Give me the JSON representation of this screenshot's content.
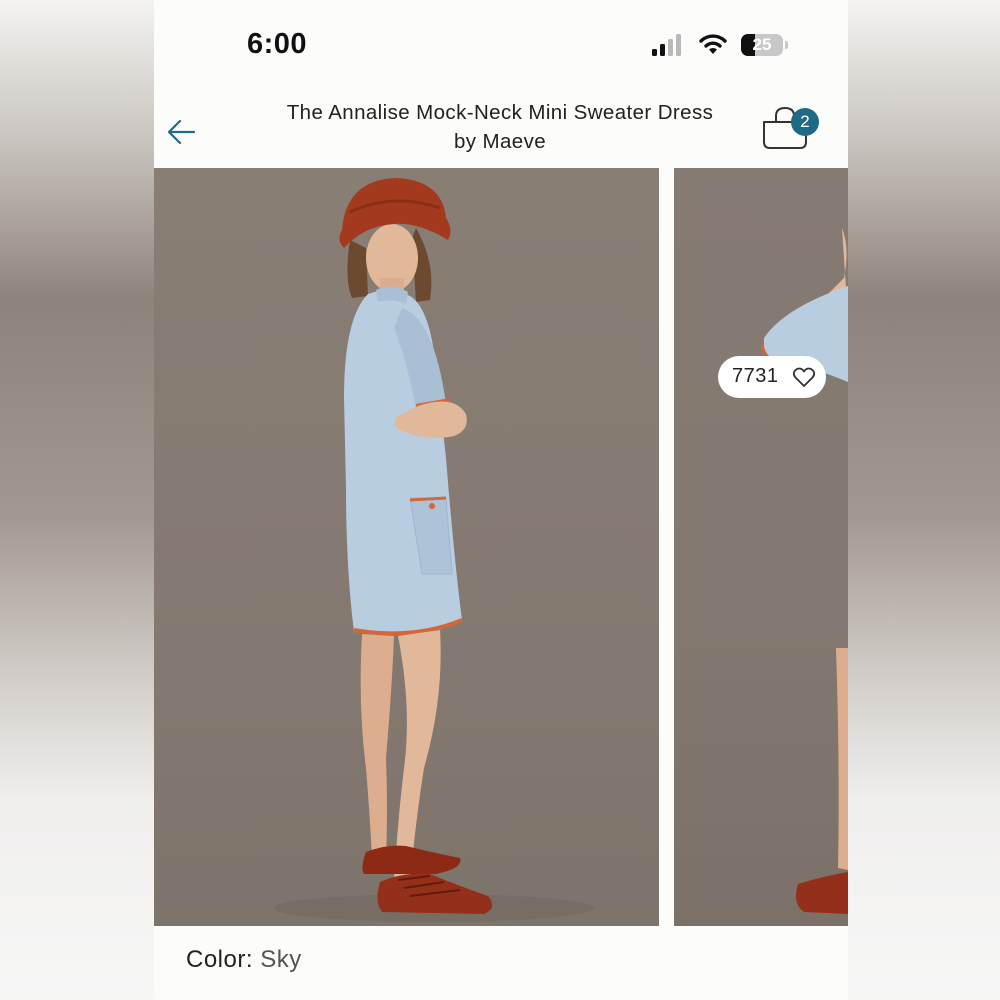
{
  "status_bar": {
    "time": "6:00",
    "battery": "25"
  },
  "header": {
    "back_icon": "arrow-left-icon",
    "title_line1": "The Annalise Mock-Neck Mini Sweater Dress",
    "title_line2": "by Maeve",
    "bag_icon": "shopping-bag-icon",
    "bag_count": "2"
  },
  "gallery": {
    "likes_count": "7731",
    "heart_icon": "heart-outline-icon"
  },
  "color": {
    "label": "Color:",
    "value": "Sky"
  },
  "colors": {
    "accent": "#1f6b86",
    "photo_bg": "#857a71",
    "dress": "#b9cde0",
    "trim": "#d4663a"
  }
}
